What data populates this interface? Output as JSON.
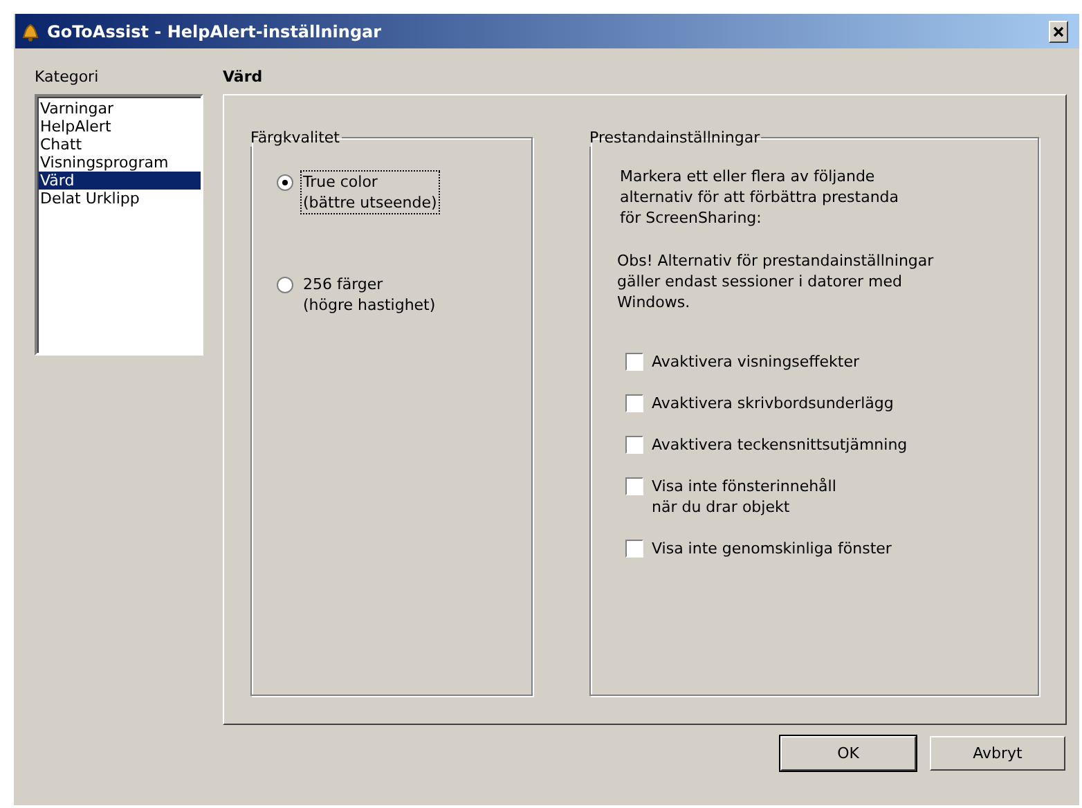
{
  "window": {
    "title": "GoToAssist - HelpAlert-inställningar"
  },
  "category": {
    "label": "Kategori",
    "items": [
      {
        "label": "Varningar",
        "selected": false
      },
      {
        "label": "HelpAlert",
        "selected": false
      },
      {
        "label": "Chatt",
        "selected": false
      },
      {
        "label": "Visningsprogram",
        "selected": false
      },
      {
        "label": "Värd",
        "selected": true
      },
      {
        "label": "Delat Urklipp",
        "selected": false
      }
    ]
  },
  "section_title": "Värd",
  "color_quality": {
    "legend": "Färgkvalitet",
    "options": [
      {
        "label": "True color",
        "sublabel": "(bättre utseende)",
        "selected": true,
        "focused": true
      },
      {
        "label": "256 färger",
        "sublabel": "(högre hastighet)",
        "selected": false,
        "focused": false
      }
    ]
  },
  "performance": {
    "legend": "Prestandainställningar",
    "intro": [
      "Markera ett eller flera av följande",
      "alternativ för att förbättra prestanda",
      "för ScreenSharing:"
    ],
    "note": [
      "Obs! Alternativ för prestandainställningar",
      "gäller endast sessioner i datorer med",
      "Windows."
    ],
    "options": [
      {
        "label": [
          "Avaktivera visningseffekter"
        ],
        "checked": false
      },
      {
        "label": [
          "Avaktivera skrivbordsunderlägg"
        ],
        "checked": false
      },
      {
        "label": [
          "Avaktivera teckensnittsutjämning"
        ],
        "checked": false
      },
      {
        "label": [
          "Visa inte fönsterinnehåll",
          "när du drar objekt"
        ],
        "checked": false
      },
      {
        "label": [
          "Visa inte genomskinliga fönster"
        ],
        "checked": false
      }
    ]
  },
  "buttons": [
    {
      "label": "OK",
      "default": true
    },
    {
      "label": "Avbryt",
      "default": false
    }
  ]
}
